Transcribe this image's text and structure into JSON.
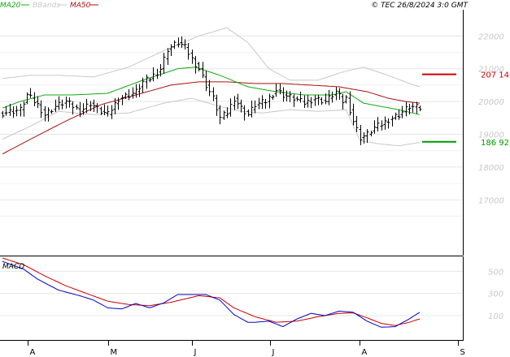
{
  "legend": [
    {
      "label": "MA20",
      "color": "#11aa11"
    },
    {
      "label": "BBands",
      "color": "#c8c8c8"
    },
    {
      "label": "MA50",
      "color": "#aa1111"
    }
  ],
  "copyright": "© TEC 26/8/2024 3:0 GMT",
  "chart_data": [
    {
      "type": "line",
      "subtype": "price-ohlc-with-overlays",
      "ylim": [
        15300,
        22800
      ],
      "y_ticks": [
        {
          "value": 17000,
          "label": "17000"
        },
        {
          "value": 18000,
          "label": "18000"
        },
        {
          "value": 19000,
          "label": "19000"
        },
        {
          "value": 20000,
          "label": "20000"
        },
        {
          "value": 21000,
          "label": "21000"
        },
        {
          "value": 22000,
          "label": "22000"
        }
      ],
      "x_ticks": [
        "A",
        "M",
        "J",
        "J",
        "A",
        "S"
      ],
      "grid": true,
      "levels": [
        {
          "label": "207 14",
          "value": 20830,
          "color": "#cc0000"
        },
        {
          "label": "186 92",
          "value": 18770,
          "color": "#009900"
        }
      ],
      "x_count": 120,
      "price_keypoints": [
        [
          0,
          19650
        ],
        [
          5,
          19750
        ],
        [
          7,
          20200
        ],
        [
          10,
          19900
        ],
        [
          12,
          19600
        ],
        [
          15,
          19850
        ],
        [
          18,
          20000
        ],
        [
          22,
          19700
        ],
        [
          25,
          19950
        ],
        [
          28,
          19700
        ],
        [
          30,
          19600
        ],
        [
          33,
          20100
        ],
        [
          36,
          20200
        ],
        [
          38,
          20300
        ],
        [
          40,
          20600
        ],
        [
          42,
          20700
        ],
        [
          45,
          21000
        ],
        [
          47,
          21600
        ],
        [
          50,
          21800
        ],
        [
          52,
          21650
        ],
        [
          54,
          21300
        ],
        [
          56,
          21000
        ],
        [
          58,
          20500
        ],
        [
          60,
          20100
        ],
        [
          62,
          19500
        ],
        [
          64,
          19650
        ],
        [
          66,
          20100
        ],
        [
          68,
          19800
        ],
        [
          70,
          19600
        ],
        [
          72,
          19900
        ],
        [
          75,
          20000
        ],
        [
          78,
          20350
        ],
        [
          80,
          20200
        ],
        [
          83,
          20100
        ],
        [
          86,
          19950
        ],
        [
          89,
          20100
        ],
        [
          92,
          20000
        ],
        [
          95,
          20300
        ],
        [
          97,
          20000
        ],
        [
          98,
          20100
        ],
        [
          100,
          19400
        ],
        [
          102,
          18900
        ],
        [
          104,
          19000
        ],
        [
          106,
          19200
        ],
        [
          108,
          19300
        ],
        [
          110,
          19450
        ],
        [
          113,
          19600
        ],
        [
          116,
          19850
        ],
        [
          119,
          19800
        ]
      ],
      "ma20_keypoints": [
        [
          0,
          19800
        ],
        [
          5,
          20000
        ],
        [
          12,
          20200
        ],
        [
          20,
          20200
        ],
        [
          30,
          20250
        ],
        [
          40,
          20650
        ],
        [
          50,
          21000
        ],
        [
          55,
          21050
        ],
        [
          62,
          20800
        ],
        [
          70,
          20450
        ],
        [
          78,
          20300
        ],
        [
          86,
          20200
        ],
        [
          94,
          20200
        ],
        [
          98,
          20300
        ],
        [
          103,
          19950
        ],
        [
          108,
          19850
        ],
        [
          113,
          19750
        ],
        [
          119,
          19600
        ]
      ],
      "ma50_keypoints": [
        [
          0,
          18400
        ],
        [
          8,
          18850
        ],
        [
          18,
          19400
        ],
        [
          28,
          19900
        ],
        [
          38,
          20200
        ],
        [
          48,
          20500
        ],
        [
          56,
          20600
        ],
        [
          64,
          20600
        ],
        [
          72,
          20550
        ],
        [
          80,
          20550
        ],
        [
          88,
          20500
        ],
        [
          96,
          20450
        ],
        [
          104,
          20300
        ],
        [
          110,
          20100
        ],
        [
          115,
          20000
        ],
        [
          119,
          19950
        ]
      ],
      "bb_upper_keypoints": [
        [
          0,
          20700
        ],
        [
          8,
          20800
        ],
        [
          16,
          20800
        ],
        [
          26,
          20750
        ],
        [
          36,
          21050
        ],
        [
          46,
          21550
        ],
        [
          56,
          22000
        ],
        [
          64,
          22250
        ],
        [
          70,
          21800
        ],
        [
          76,
          21000
        ],
        [
          82,
          20650
        ],
        [
          90,
          20650
        ],
        [
          97,
          20900
        ],
        [
          103,
          21050
        ],
        [
          110,
          20800
        ],
        [
          116,
          20550
        ],
        [
          119,
          20450
        ]
      ],
      "bb_lower_keypoints": [
        [
          0,
          18850
        ],
        [
          8,
          19250
        ],
        [
          16,
          19700
        ],
        [
          26,
          19600
        ],
        [
          36,
          19650
        ],
        [
          46,
          19950
        ],
        [
          54,
          20100
        ],
        [
          62,
          19850
        ],
        [
          68,
          19700
        ],
        [
          74,
          19650
        ],
        [
          82,
          19750
        ],
        [
          90,
          19700
        ],
        [
          98,
          19750
        ],
        [
          102,
          18800
        ],
        [
          108,
          18700
        ],
        [
          113,
          18650
        ],
        [
          119,
          18750
        ]
      ]
    },
    {
      "type": "line",
      "subtype": "macd-panel",
      "title": "MACD",
      "ylim": [
        -120,
        620
      ],
      "y_ticks": [
        {
          "value": 100,
          "label": "100"
        },
        {
          "value": 300,
          "label": "300"
        },
        {
          "value": 500,
          "label": "500"
        }
      ],
      "macd_keypoints": [
        [
          0,
          590
        ],
        [
          6,
          520
        ],
        [
          10,
          430
        ],
        [
          16,
          330
        ],
        [
          22,
          280
        ],
        [
          26,
          240
        ],
        [
          30,
          170
        ],
        [
          34,
          160
        ],
        [
          38,
          210
        ],
        [
          42,
          170
        ],
        [
          46,
          215
        ],
        [
          50,
          290
        ],
        [
          55,
          290
        ],
        [
          58,
          290
        ],
        [
          62,
          240
        ],
        [
          66,
          110
        ],
        [
          70,
          40
        ],
        [
          72,
          40
        ],
        [
          76,
          50
        ],
        [
          80,
          0
        ],
        [
          84,
          70
        ],
        [
          88,
          120
        ],
        [
          92,
          100
        ],
        [
          96,
          140
        ],
        [
          100,
          130
        ],
        [
          104,
          50
        ],
        [
          108,
          -5
        ],
        [
          112,
          0
        ],
        [
          116,
          70
        ],
        [
          119,
          130
        ]
      ],
      "signal_keypoints": [
        [
          0,
          620
        ],
        [
          6,
          560
        ],
        [
          12,
          460
        ],
        [
          18,
          370
        ],
        [
          24,
          300
        ],
        [
          30,
          230
        ],
        [
          36,
          200
        ],
        [
          42,
          190
        ],
        [
          48,
          220
        ],
        [
          56,
          280
        ],
        [
          62,
          260
        ],
        [
          66,
          170
        ],
        [
          72,
          90
        ],
        [
          78,
          40
        ],
        [
          84,
          50
        ],
        [
          90,
          90
        ],
        [
          96,
          120
        ],
        [
          100,
          125
        ],
        [
          104,
          80
        ],
        [
          108,
          30
        ],
        [
          112,
          10
        ],
        [
          116,
          40
        ],
        [
          119,
          70
        ]
      ]
    }
  ]
}
